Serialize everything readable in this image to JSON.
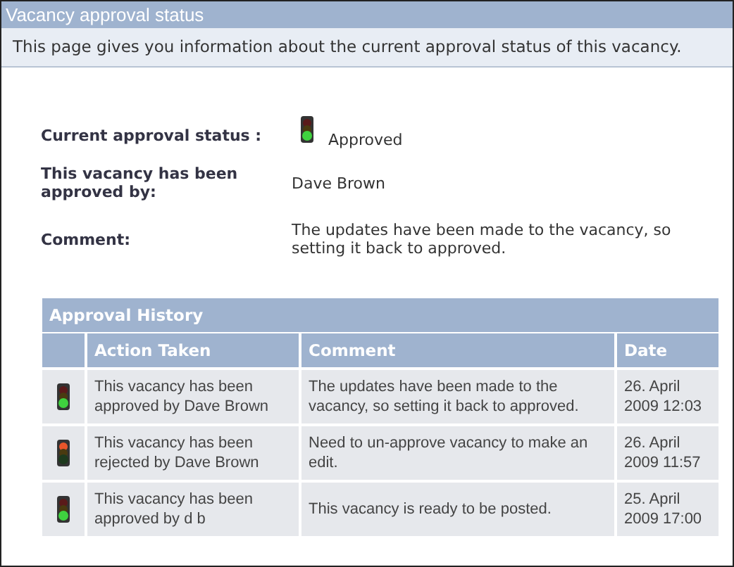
{
  "window": {
    "title": "Vacancy approval status"
  },
  "intro": "This page gives you information about the current approval status of this vacancy.",
  "details": [
    {
      "label": "Current approval status :",
      "value": "Approved",
      "kind": "approved"
    },
    {
      "label": "This vacancy has been approved by:",
      "value": "Dave Brown"
    },
    {
      "label": "Comment:",
      "value": "The updates have been made to the vacancy, so setting it back to approved."
    }
  ],
  "history": {
    "title": "Approval History",
    "columns": [
      "Action Taken",
      "Comment",
      "Date"
    ],
    "rows": [
      {
        "kind": "approved",
        "action": "This vacancy has been approved by Dave Brown",
        "comment": "The updates have been made to the vacancy, so setting it back to approved.",
        "date": "26. April 2009 12:03"
      },
      {
        "kind": "rejected",
        "action": "This vacancy has been rejected by Dave Brown",
        "comment": "Need to un-approve vacancy to make an edit.",
        "date": "26. April 2009 11:57"
      },
      {
        "kind": "approved",
        "action": "This vacancy has been approved by d b",
        "comment": "This vacancy is ready to be posted.",
        "date": "25. April 2009 17:00"
      }
    ]
  }
}
